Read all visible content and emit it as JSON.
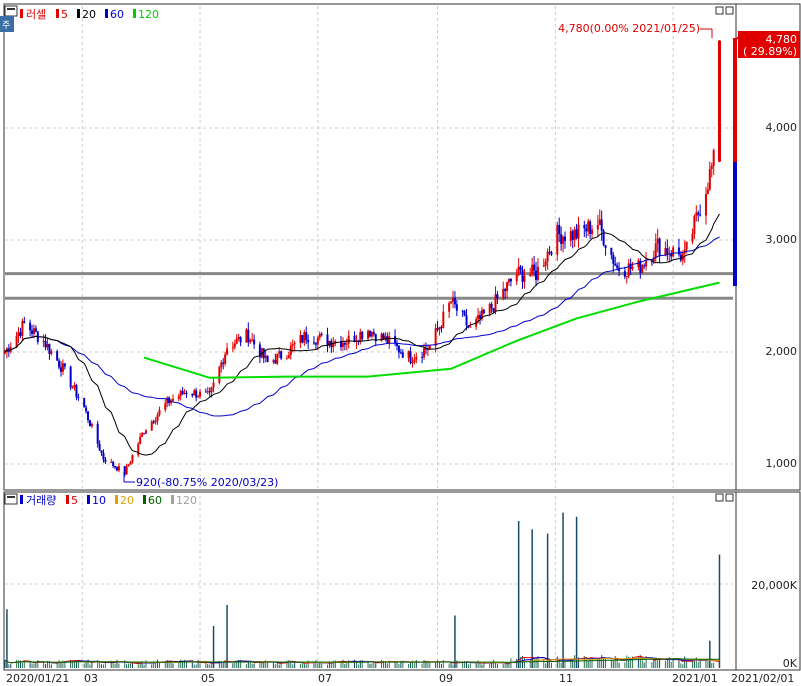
{
  "price_panel": {
    "legend": {
      "name": "러셀",
      "ma_labels": [
        "5",
        "20",
        "60",
        "120"
      ],
      "ma_colors": [
        "#e00000",
        "#000000",
        "#0000cc",
        "#00cc00"
      ]
    },
    "max_label": "4,780(0.00% 2021/01/25)",
    "min_label": "920(-80.75% 2020/03/23)",
    "current_price": "4,780",
    "current_change": "( 29.89%)",
    "y_ticks": [
      "4,000",
      "3,000",
      "2,000",
      "1,000"
    ]
  },
  "volume_panel": {
    "legend": {
      "name": "거래량",
      "ma_labels": [
        "5",
        "10",
        "20",
        "60",
        "120"
      ],
      "ma_colors": [
        "#e00000",
        "#0000cc",
        "#e0a000",
        "#006000",
        "#a0a0a0"
      ]
    },
    "y_ticks": [
      "20,000K",
      "0K"
    ]
  },
  "x_labels": [
    "2020/01/21",
    "03",
    "05",
    "07",
    "09",
    "11",
    "2021/01",
    "2021/02/01"
  ],
  "colors": {
    "up": "#e00000",
    "down": "#0000cc",
    "ma5": "#e00000",
    "ma20": "#000000",
    "ma60": "#0000cc",
    "ma120": "#00dd00",
    "grid": "#cccccc",
    "hline": "#888888"
  },
  "chart_data": [
    {
      "type": "line",
      "series": [
        {
          "name": "러셀",
          "x": [
            "2020/01/21",
            "2020/01/31",
            "2020/02/10",
            "2020/02/20",
            "2020/03/02",
            "2020/03/12",
            "2020/03/23",
            "2020/04/02",
            "2020/04/14",
            "2020/04/24",
            "2020/05/06",
            "2020/05/15",
            "2020/05/26",
            "2020/06/05",
            "2020/06/15",
            "2020/06/25",
            "2020/07/06",
            "2020/07/16",
            "2020/07/27",
            "2020/08/06",
            "2020/08/18",
            "2020/08/28",
            "2020/09/08",
            "2020/09/18",
            "2020/09/29",
            "2020/10/12",
            "2020/10/22",
            "2020/11/02",
            "2020/11/12",
            "2020/11/23",
            "2020/12/03",
            "2020/12/14",
            "2020/12/24",
            "2021/01/07",
            "2021/01/15",
            "2021/01/22",
            "2021/01/25"
          ],
          "values": [
            2000,
            2250,
            2100,
            1850,
            1500,
            1050,
            920,
            1300,
            1550,
            1650,
            1600,
            2050,
            2150,
            1900,
            2000,
            2150,
            2100,
            2100,
            2200,
            2100,
            1950,
            2050,
            2450,
            2200,
            2400,
            2700,
            2700,
            3050,
            3050,
            3150,
            2750,
            2750,
            2950,
            2850,
            3300,
            3700,
            4780
          ]
        },
        {
          "name": "120",
          "x": [
            "2020/04/02",
            "2020/05/06",
            "2020/06/15",
            "2020/07/27",
            "2020/09/08",
            "2020/10/12",
            "2020/11/12",
            "2020/12/14",
            "2021/01/25"
          ],
          "values": [
            1950,
            1770,
            1780,
            1780,
            1850,
            2100,
            2300,
            2450,
            2620
          ]
        }
      ],
      "ylim": [
        800,
        5000
      ],
      "support_levels": [
        2700,
        2480
      ]
    },
    {
      "type": "bar",
      "series": [
        {
          "name": "거래량",
          "x": [
            "2020/01/22",
            "2020/05/08",
            "2020/05/15",
            "2020/09/10",
            "2020/10/13",
            "2020/10/20",
            "2020/10/28",
            "2020/11/05",
            "2020/11/12",
            "2021/01/20",
            "2021/01/25"
          ],
          "values": [
            14000,
            10000,
            15000,
            12500,
            35000,
            33000,
            32000,
            37000,
            36000,
            6500,
            27000
          ]
        }
      ],
      "ylim": [
        0,
        40000
      ]
    }
  ]
}
